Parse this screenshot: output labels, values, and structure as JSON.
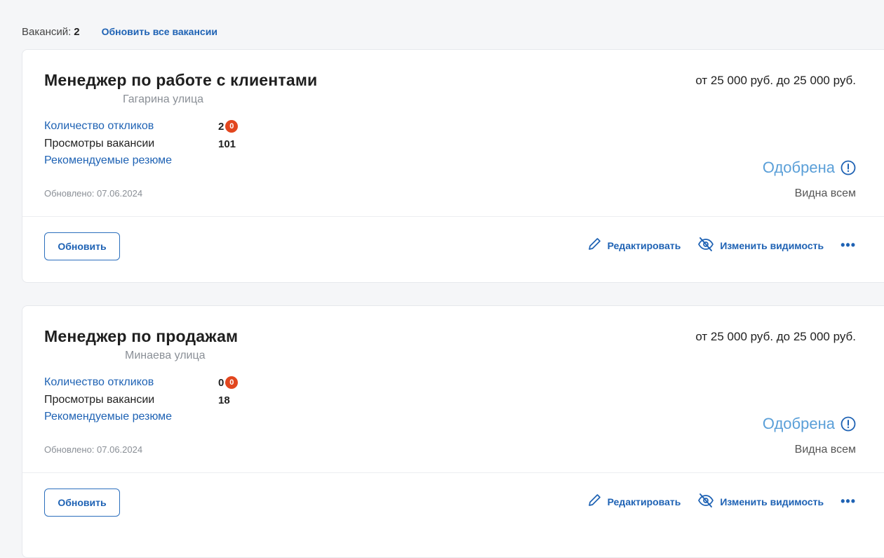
{
  "header": {
    "count_label": "Вакансий:",
    "count_value": "2",
    "refresh_all_label": "Обновить все вакансии"
  },
  "vacancies": [
    {
      "title": "Менеджер по работе с клиентами",
      "address": "Гагарина улица",
      "salary": "от 25 000 руб. до 25 000 руб.",
      "responses_label": "Количество откликов",
      "responses_value": "2",
      "responses_new": "0",
      "views_label": "Просмотры вакансии",
      "views_value": "101",
      "recommended_label": "Рекомендуемые резюме",
      "updated": "Обновлено: 07.06.2024",
      "status": "Одобрена",
      "visibility": "Видна всем",
      "refresh_label": "Обновить",
      "edit_label": "Редактировать",
      "change_visibility_label": "Изменить видимость",
      "more_label": "•••"
    },
    {
      "title": "Менеджер по продажам",
      "address": "Минаева улица",
      "salary": "от 25 000 руб. до 25 000 руб.",
      "responses_label": "Количество откликов",
      "responses_value": "0",
      "responses_new": "0",
      "views_label": "Просмотры вакансии",
      "views_value": "18",
      "recommended_label": "Рекомендуемые резюме",
      "updated": "Обновлено: 07.06.2024",
      "status": "Одобрена",
      "visibility": "Видна всем",
      "refresh_label": "Обновить",
      "edit_label": "Редактировать",
      "change_visibility_label": "Изменить видимость",
      "more_label": "•••"
    }
  ],
  "colors": {
    "accent": "#1e62b4",
    "status": "#5a9fd8",
    "badge": "#e2461e",
    "muted": "#8a8f96"
  },
  "icons": {
    "edit": "pencil-icon",
    "visibility": "eye-off-icon",
    "status": "info-circle-icon"
  }
}
